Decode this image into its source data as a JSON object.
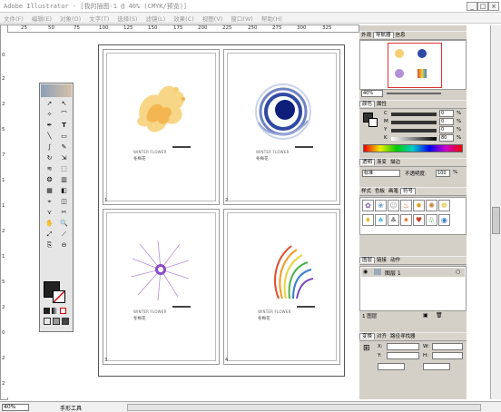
{
  "window": {
    "title": "Adobe Illustrator - [我的插图-1 @ 40% (CMYK/预览)]",
    "controls": {
      "minimize": "_",
      "maximize": "□",
      "close": "×"
    }
  },
  "menu": [
    "文件(F)",
    "编辑(E)",
    "对象(O)",
    "文字(T)",
    "选择(S)",
    "滤镜(L)",
    "效果(C)",
    "视图(V)",
    "窗口(W)",
    "帮助(H)"
  ],
  "ruler_top": [
    "25",
    "50",
    "75",
    "100",
    "125",
    "150",
    "175",
    "200",
    "225",
    "250",
    "275",
    "300",
    "325"
  ],
  "ruler_left": [
    "0",
    "2",
    "2",
    "5",
    "7",
    "1",
    "1",
    "2",
    "1",
    "5",
    "2",
    "0",
    "2",
    "2"
  ],
  "artboards": [
    {
      "number": "1",
      "label_en": "WINTER FLOWER",
      "label_cn": "冬梅花"
    },
    {
      "number": "2",
      "label_en": "WINTER FLOWER",
      "label_cn": "冬梅花"
    },
    {
      "number": "3",
      "label_en": "WINTER FLOWER",
      "label_cn": "冬梅花"
    },
    {
      "number": "4",
      "label_en": "WINTER FLOWER",
      "label_cn": "冬梅花"
    }
  ],
  "panels": {
    "navigator": {
      "tabs": [
        "外观",
        "导航器",
        "信息"
      ],
      "zoom": "40%"
    },
    "color": {
      "tabs": [
        "颜色",
        "属性"
      ],
      "channels": [
        "C",
        "M",
        "Y",
        "K"
      ],
      "values": [
        "0",
        "0",
        "0",
        "80"
      ],
      "unit": "%"
    },
    "transparency": {
      "tabs": [
        "透明",
        "渐变",
        "描边"
      ],
      "mode": "标准",
      "opacity_label": "不透明度:",
      "opacity": "100",
      "unit": "%"
    },
    "swatches": {
      "tabs": [
        "样式",
        "色板",
        "画笔",
        "符号"
      ]
    },
    "layers": {
      "tabs": [
        "图层",
        "链接",
        "动作"
      ],
      "layer_name": "图层 1",
      "count": "1 图层"
    },
    "transform": {
      "tabs": [
        "变换",
        "对齐",
        "路径寻找器"
      ],
      "x_label": "X:",
      "y_label": "Y:",
      "w_label": "W:",
      "h_label": "H:"
    }
  },
  "status": {
    "zoom": "40%",
    "tool": "手形工具"
  }
}
